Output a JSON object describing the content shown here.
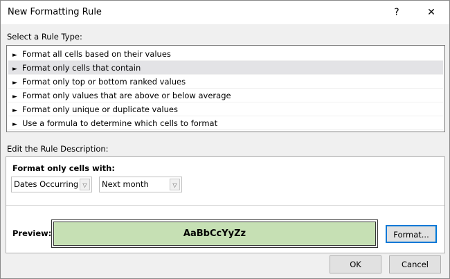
{
  "title": "New Formatting Rule",
  "help_label": "?",
  "close_label": "✕",
  "rule_type_label": "Select a Rule Type:",
  "rule_types": [
    {
      "label": "Format all cells based on their values"
    },
    {
      "label": "Format only cells that contain",
      "selected": true
    },
    {
      "label": "Format only top or bottom ranked values"
    },
    {
      "label": "Format only values that are above or below average"
    },
    {
      "label": "Format only unique or duplicate values"
    },
    {
      "label": "Use a formula to determine which cells to format"
    }
  ],
  "description_label": "Edit the Rule Description:",
  "format_only_label": "Format only cells with:",
  "condition_select": "Dates Occurring",
  "period_select": "Next month",
  "preview_label": "Preview:",
  "preview_text": "AaBbCcYyZz",
  "preview_color": "#c6e0b4",
  "format_button": "Format...",
  "ok_button": "OK",
  "cancel_button": "Cancel"
}
